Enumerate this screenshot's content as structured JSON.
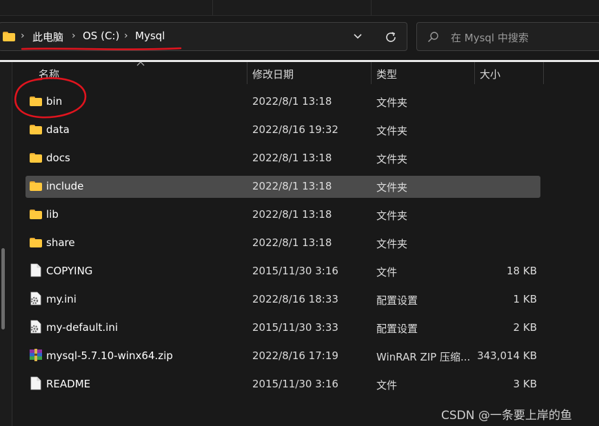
{
  "breadcrumb": {
    "items": [
      "此电脑",
      "OS (C:)",
      "Mysql"
    ],
    "separator": "›"
  },
  "search": {
    "placeholder": "在 Mysql 中搜索"
  },
  "columns": {
    "name": "名称",
    "date": "修改日期",
    "type": "类型",
    "size": "大小"
  },
  "files": [
    {
      "name": "bin",
      "date": "2022/8/1 13:18",
      "type": "文件夹",
      "size": "",
      "icon": "folder-icon"
    },
    {
      "name": "data",
      "date": "2022/8/16 19:32",
      "type": "文件夹",
      "size": "",
      "icon": "folder-icon"
    },
    {
      "name": "docs",
      "date": "2022/8/1 13:18",
      "type": "文件夹",
      "size": "",
      "icon": "folder-icon"
    },
    {
      "name": "include",
      "date": "2022/8/1 13:18",
      "type": "文件夹",
      "size": "",
      "icon": "folder-icon",
      "selected": true
    },
    {
      "name": "lib",
      "date": "2022/8/1 13:18",
      "type": "文件夹",
      "size": "",
      "icon": "folder-icon"
    },
    {
      "name": "share",
      "date": "2022/8/1 13:18",
      "type": "文件夹",
      "size": "",
      "icon": "folder-icon"
    },
    {
      "name": "COPYING",
      "date": "2015/11/30 3:16",
      "type": "文件",
      "size": "18 KB",
      "icon": "file-icon"
    },
    {
      "name": "my.ini",
      "date": "2022/8/16 18:33",
      "type": "配置设置",
      "size": "1 KB",
      "icon": "config-file-icon"
    },
    {
      "name": "my-default.ini",
      "date": "2015/11/30 3:33",
      "type": "配置设置",
      "size": "2 KB",
      "icon": "config-file-icon"
    },
    {
      "name": "mysql-5.7.10-winx64.zip",
      "date": "2022/8/16 17:19",
      "type": "WinRAR ZIP 压缩...",
      "size": "343,014 KB",
      "icon": "winrar-archive-icon"
    },
    {
      "name": "README",
      "date": "2015/11/30 3:16",
      "type": "文件",
      "size": "3 KB",
      "icon": "file-icon"
    }
  ],
  "watermark": "CSDN @一条要上岸的鱼",
  "colors": {
    "background": "#191919",
    "selection": "#4b4b4b",
    "folder": "#ffc83d",
    "annotation": "#e0141e"
  }
}
